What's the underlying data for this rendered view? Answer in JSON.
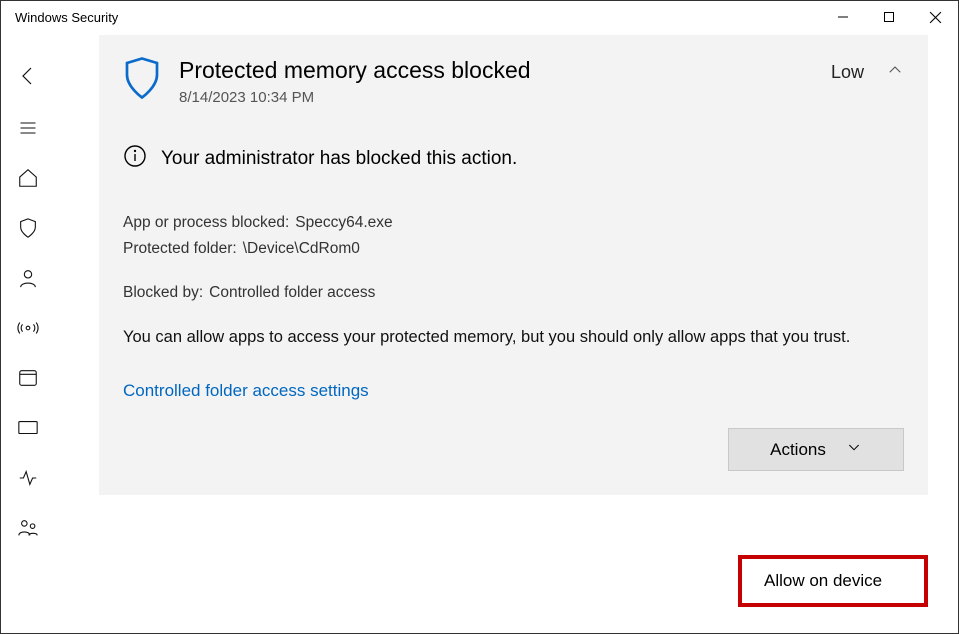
{
  "window": {
    "title": "Windows Security"
  },
  "truncated_top": "",
  "card": {
    "title": "Protected memory access blocked",
    "timestamp": "8/14/2023 10:34 PM",
    "severity": "Low",
    "admin_message": "Your administrator has blocked this action.",
    "labels": {
      "app_blocked": "App or process blocked:",
      "protected_folder": "Protected folder:",
      "blocked_by": "Blocked by:"
    },
    "values": {
      "app_blocked": "Speccy64.exe",
      "protected_folder": "\\Device\\CdRom0",
      "blocked_by": "Controlled folder access"
    },
    "description": "You can allow apps to access your protected memory, but you should only allow apps that you trust.",
    "link": "Controlled folder access settings",
    "actions_label": "Actions"
  },
  "menu": {
    "allow": "Allow on device"
  }
}
